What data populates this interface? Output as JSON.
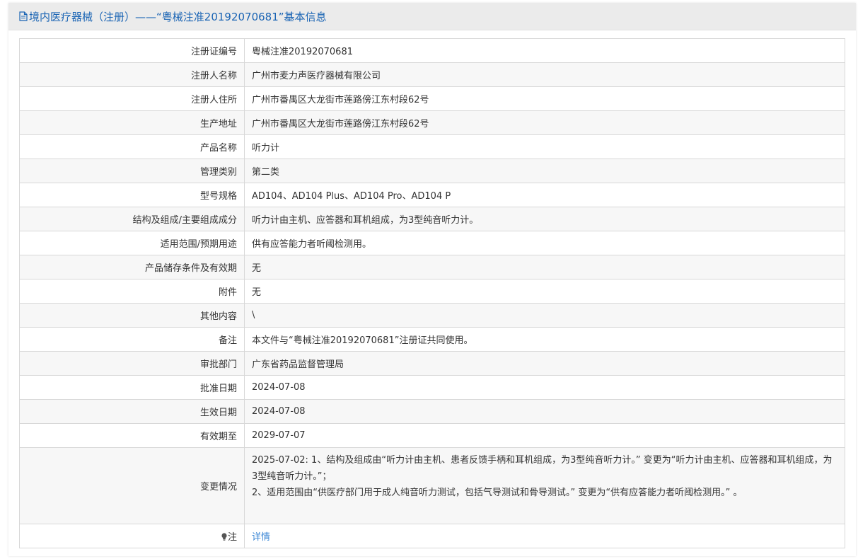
{
  "header": {
    "title": "境内医疗器械（注册）——“粤械注准20192070681”基本信息",
    "icon": "document-icon"
  },
  "rows": [
    {
      "label": "注册证编号",
      "value": "粤械注准20192070681"
    },
    {
      "label": "注册人名称",
      "value": "广州市麦力声医疗器械有限公司"
    },
    {
      "label": "注册人住所",
      "value": "广州市番禺区大龙街市莲路傍江东村段62号"
    },
    {
      "label": "生产地址",
      "value": "广州市番禺区大龙街市莲路傍江东村段62号"
    },
    {
      "label": "产品名称",
      "value": "听力计"
    },
    {
      "label": "管理类别",
      "value": "第二类"
    },
    {
      "label": "型号规格",
      "value": "AD104、AD104 Plus、AD104 Pro、AD104 P"
    },
    {
      "label": "结构及组成/主要组成成分",
      "value": "听力计由主机、应答器和耳机组成，为3型纯音听力计。"
    },
    {
      "label": "适用范围/预期用途",
      "value": "供有应答能力者听阈检测用。"
    },
    {
      "label": "产品储存条件及有效期",
      "value": "无"
    },
    {
      "label": "附件",
      "value": "无"
    },
    {
      "label": "其他内容",
      "value": "\\"
    },
    {
      "label": "备注",
      "value": "本文件与“粤械注准20192070681”注册证共同使用。"
    },
    {
      "label": "审批部门",
      "value": "广东省药品监督管理局"
    },
    {
      "label": "批准日期",
      "value": "2024-07-08"
    },
    {
      "label": "生效日期",
      "value": "2024-07-08"
    },
    {
      "label": "有效期至",
      "value": "2029-07-07"
    }
  ],
  "change": {
    "label": "变更情况",
    "line1": "2025-07-02: 1、结构及组成由“听力计由主机、患者反馈手柄和耳机组成，为3型纯音听力计。” 变更为“听力计由主机、应答器和耳机组成，为3型纯音听力计。”；",
    "line2": "2、适用范围由“供医疗部门用于成人纯音听力测试，包括气导测试和骨导测试。” 变更为“供有应答能力者听阈检测用。” 。"
  },
  "note": {
    "label": "注",
    "icon": "lightbulb-icon",
    "link": "详情"
  }
}
